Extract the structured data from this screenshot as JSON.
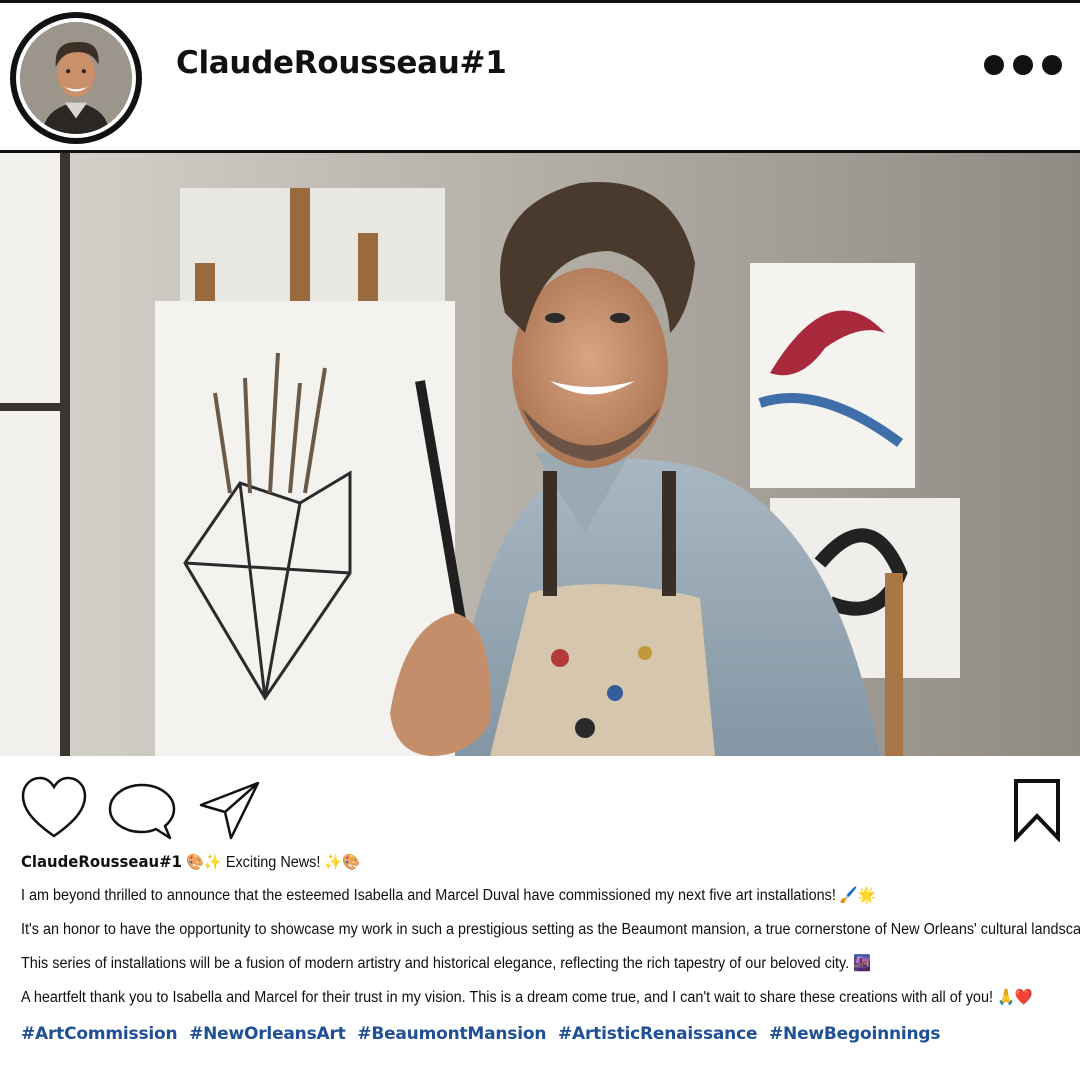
{
  "post": {
    "username": "ClaudeRousseau#1",
    "more_icon": "more-horizontal-icon",
    "photo": {
      "alt_icon": "artist-portrait-image"
    },
    "actions": {
      "like_icon": "heart-icon",
      "comment_icon": "comment-icon",
      "share_icon": "send-icon",
      "save_icon": "bookmark-icon"
    },
    "caption": {
      "username": "ClaudeRousseau#1",
      "headline": "🎨✨ Exciting News! ✨🎨",
      "lines": [
        "I am beyond thrilled to announce that the esteemed Isabella and Marcel Duval have commissioned my next five art installations! 🖌️🌟",
        "It's an honor to have the opportunity to showcase my work in such a prestigious setting as the Beaumont mansion, a true cornerstone of New Orleans' cultural landscape. 🏛️",
        "This series of installations will be a fusion of modern artistry and historical elegance, reflecting the rich tapestry of our beloved city. 🌆",
        "A heartfelt thank you to Isabella and Marcel for their trust in my vision. This is a dream come true, and I can't wait to share these creations with all of you! 🙏❤️"
      ],
      "hashtags": [
        "#ArtCommission",
        "#NewOrleansArt",
        "#BeaumontMansion",
        "#ArtisticRenaissance",
        "#NewBegoinnings"
      ]
    },
    "colors": {
      "text": "#111111",
      "hashtag": "#1f4f94",
      "background": "#ffffff"
    }
  }
}
